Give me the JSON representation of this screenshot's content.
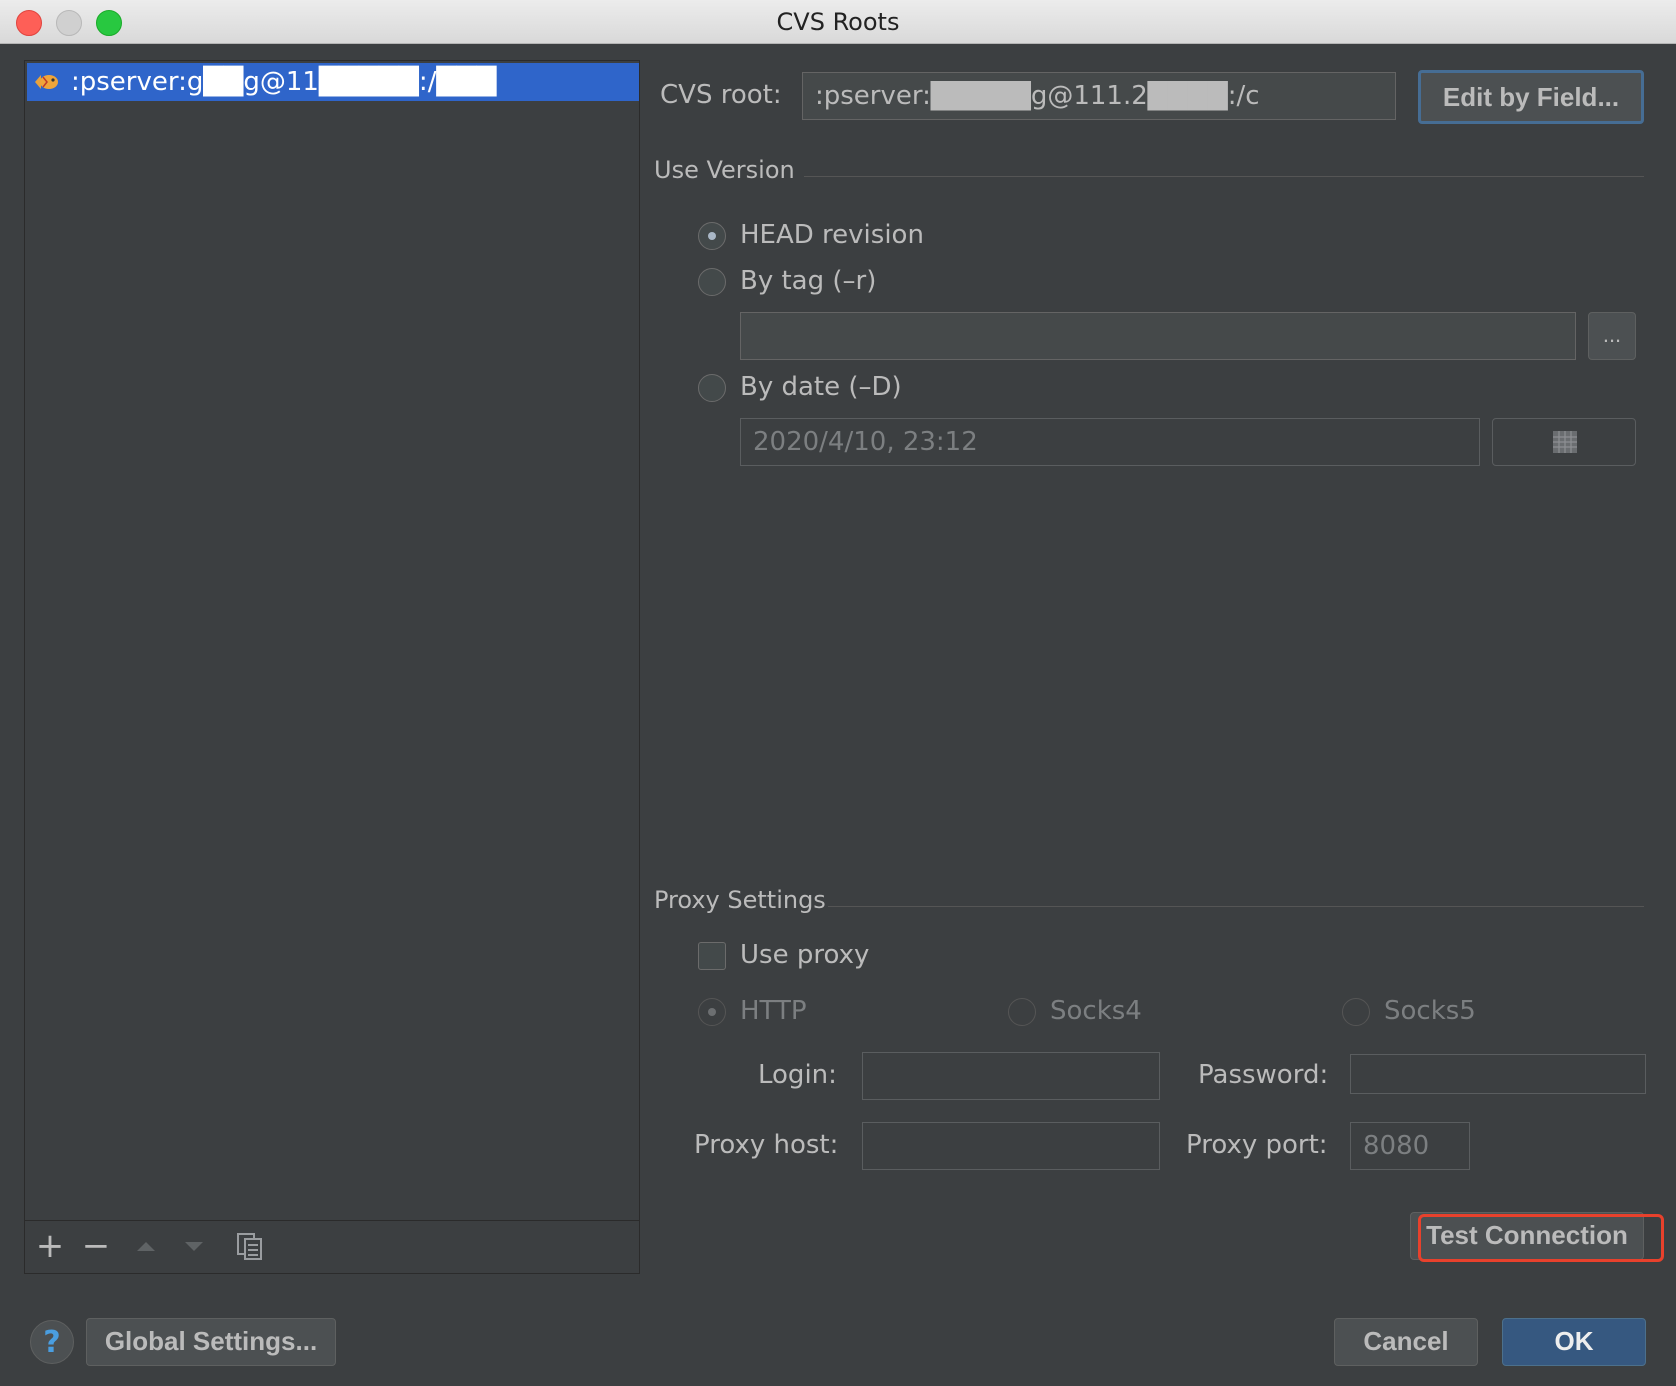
{
  "window": {
    "title": "CVS Roots"
  },
  "roots_list": {
    "items": [
      {
        "label": ":pserver:g██g@11█████:/███"
      }
    ],
    "toolbar": {
      "add_symbol": "+",
      "remove_symbol": "−"
    }
  },
  "cvs_root": {
    "label": "CVS root:",
    "value": ":pserver:█████g@111.2████:/c",
    "edit_button": "Edit by Field..."
  },
  "use_version": {
    "title": "Use Version",
    "head_revision": "HEAD revision",
    "by_tag": "By tag (–r)",
    "tag_value": "",
    "browse_button": "...",
    "by_date": "By date (–D)",
    "date_value": "2020/4/10, 23:12"
  },
  "proxy": {
    "title": "Proxy Settings",
    "use_proxy": "Use proxy",
    "http": "HTTP",
    "socks4": "Socks4",
    "socks5": "Socks5",
    "login_label": "Login:",
    "login_value": "",
    "password_label": "Password:",
    "password_value": "",
    "host_label": "Proxy host:",
    "host_value": "",
    "port_label": "Proxy port:",
    "port_value": "8080"
  },
  "buttons": {
    "test_connection": "Test Connection",
    "help": "?",
    "global_settings": "Global Settings...",
    "cancel": "Cancel",
    "ok": "OK"
  },
  "colors": {
    "selection": "#2f65ca",
    "highlight_border": "#e8412c",
    "default_button": "#365880"
  }
}
